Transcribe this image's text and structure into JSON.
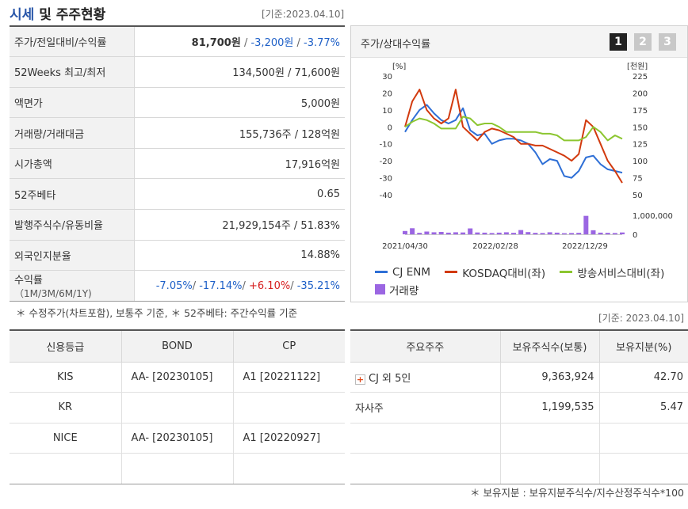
{
  "header": {
    "title_part1": "시세",
    "title_part2": " 및 주주현황",
    "base_date": "[기준:2023.04.10]"
  },
  "price_rows": {
    "r0": {
      "label": "주가/전일대비/수익률",
      "price": "81,700원",
      "slash1": " / ",
      "change": "-3,200원",
      "slash2": " / ",
      "rate": "-3.77%"
    },
    "r1": {
      "label": "52Weeks 최고/최저",
      "value": "134,500원 / 71,600원"
    },
    "r2": {
      "label": "액면가",
      "value": "5,000원"
    },
    "r3": {
      "label": "거래량/거래대금",
      "value": "155,736주 / 128억원"
    },
    "r4": {
      "label": "시가총액",
      "value": "17,916억원"
    },
    "r5": {
      "label": "52주베타",
      "value": "0.65"
    },
    "r6": {
      "label": "발행주식수/유동비율",
      "value": "21,929,154주 / 51.83%"
    },
    "r7": {
      "label": "외국인지분율",
      "value": "14.88%"
    },
    "r8": {
      "label": "수익률",
      "sublabel": "（1M/3M/6M/1Y)",
      "v1": "-7.05%",
      "v2": "-17.14%",
      "v3": "+6.10%",
      "v4": "-35.21%",
      "slash": "/ "
    }
  },
  "price_note": "＊ 수정주가(차트포함), 보통주 기준, ＊ 52주베타: 주간수익률 기준",
  "chart_panel": {
    "title": "주가/상대수익률",
    "pages": [
      "1",
      "2",
      "3"
    ],
    "active_page": "1"
  },
  "chart_data": {
    "type": "line",
    "left_axis_label": "[%]",
    "right_axis_label": "[천원]",
    "left_ticks": [
      "30",
      "20",
      "10",
      "0",
      "-10",
      "-20",
      "-30",
      "-40"
    ],
    "right_ticks": [
      "225",
      "200",
      "175",
      "150",
      "125",
      "100",
      "75",
      "50"
    ],
    "volume_ticks": [
      "1,000,000",
      "0"
    ],
    "x_labels": [
      "2021/04/30",
      "2022/02/28",
      "2022/12/29"
    ],
    "ylim_left": [
      -40,
      30
    ],
    "ylim_right": [
      50,
      225
    ],
    "series": [
      {
        "name": "CJ ENM",
        "color": "#2e6fd6",
        "axis": "left",
        "values": [
          -3,
          4,
          10,
          13,
          8,
          4,
          2,
          4,
          11,
          -2,
          -5,
          -4,
          -10,
          -8,
          -7,
          -7,
          -8,
          -10,
          -15,
          -22,
          -19,
          -20,
          -29,
          -30,
          -26,
          -18,
          -17,
          -22,
          -25,
          -26,
          -27
        ]
      },
      {
        "name": "KOSDAQ대비(좌)",
        "color": "#d23a0e",
        "axis": "left",
        "values": [
          0,
          15,
          22,
          10,
          5,
          2,
          5,
          22,
          0,
          -4,
          -8,
          -3,
          -1,
          -2,
          -4,
          -6,
          -10,
          -10,
          -11,
          -11,
          -13,
          -15,
          -17,
          -20,
          -16,
          4,
          0,
          -10,
          -20,
          -26,
          -33
        ]
      },
      {
        "name": "방송서비스대비(좌)",
        "color": "#8cc630",
        "axis": "left",
        "values": [
          0,
          3,
          5,
          4,
          2,
          -1,
          -1,
          -1,
          6,
          5,
          1,
          2,
          2,
          0,
          -3,
          -3,
          -3,
          -3,
          -3,
          -4,
          -4,
          -5,
          -8,
          -8,
          -8,
          -6,
          0,
          -3,
          -8,
          -5,
          -7
        ]
      },
      {
        "name": "거래량",
        "color": "#9b66e2",
        "axis": "volume",
        "values": [
          180000,
          330000,
          80000,
          150000,
          110000,
          130000,
          90000,
          110000,
          100000,
          320000,
          100000,
          90000,
          70000,
          90000,
          110000,
          80000,
          230000,
          120000,
          80000,
          70000,
          110000,
          90000,
          60000,
          70000,
          80000,
          1000000,
          220000,
          90000,
          80000,
          70000,
          100000
        ]
      }
    ],
    "volume_max": 1200000
  },
  "holder_base_date": "[기준: 2023.04.10]",
  "credit_table": {
    "headers": [
      "신용등급",
      "BOND",
      "CP"
    ],
    "rows": [
      [
        "KIS",
        "AA-  [20230105]",
        "A1  [20221122]"
      ],
      [
        "KR",
        "",
        ""
      ],
      [
        "NICE",
        "AA-  [20230105]",
        "A1  [20220927]"
      ],
      [
        "",
        "",
        ""
      ]
    ]
  },
  "holder_table": {
    "headers": [
      "주요주주",
      "보유주식수(보통)",
      "보유지분(%)"
    ],
    "rows": [
      [
        "CJ 외 5인",
        "9,363,924",
        "42.70"
      ],
      [
        "자사주",
        "1,199,535",
        "5.47"
      ],
      [
        "",
        "",
        ""
      ],
      [
        "",
        "",
        ""
      ]
    ]
  },
  "holder_note": "＊ 보유지분 : 보유지분주식수/지수산정주식수*100"
}
